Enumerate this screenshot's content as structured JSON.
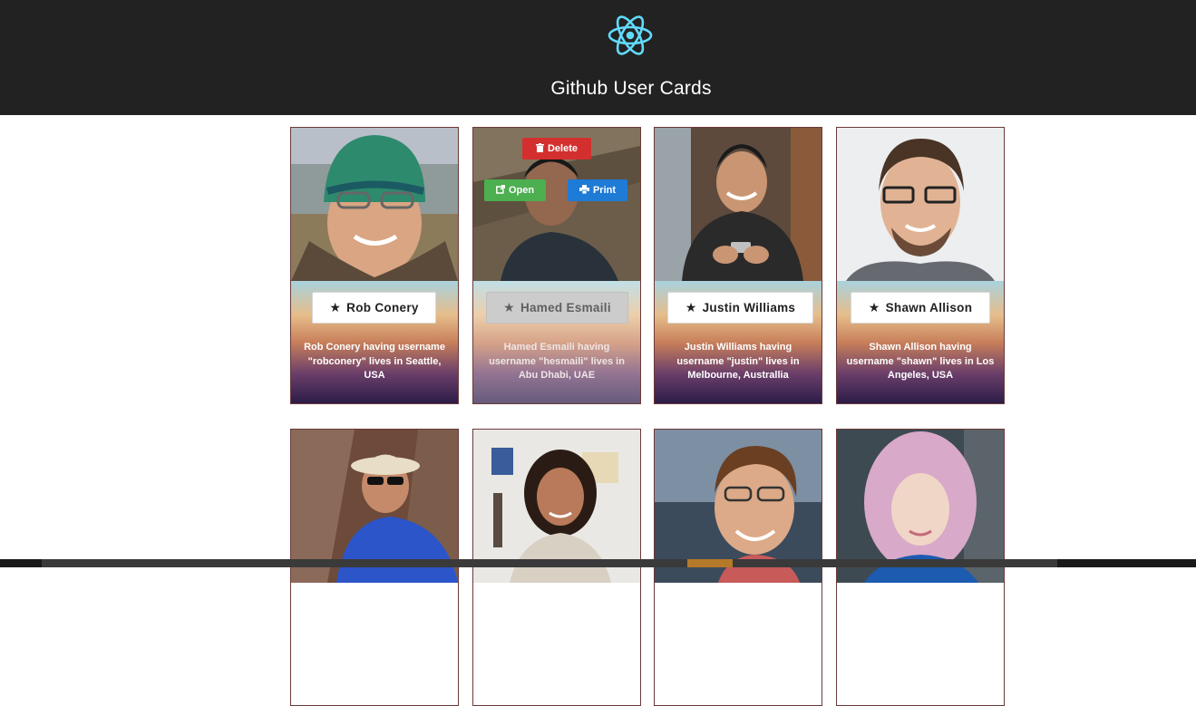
{
  "app": {
    "title": "Github User Cards",
    "logo": "react-logo-icon"
  },
  "cards": [
    {
      "name": "Rob Conery",
      "description": "Rob Conery having username \"robconery\" lives in Seattle, USA"
    },
    {
      "name": "Hamed Esmaili",
      "description": "Hamed Esmaili having username \"hesmaili\" lives in Abu Dhabi, UAE"
    },
    {
      "name": "Justin Williams",
      "description": "Justin Williams having username \"justin\" lives in Melbourne, Australlia"
    },
    {
      "name": "Shawn Allison",
      "description": "Shawn Allison having username \"shawn\" lives in Los Angeles, USA"
    }
  ],
  "actions": {
    "delete": "Delete",
    "open": "Open",
    "print": "Print"
  },
  "icons": {
    "star": "star-icon",
    "delete": "trash-icon",
    "open": "external-link-icon",
    "print": "printer-icon"
  },
  "colors": {
    "header": "#222222",
    "delete": "#d32f2f",
    "open": "#4caf50",
    "print": "#1e7bd6",
    "react": "#61dafb"
  }
}
